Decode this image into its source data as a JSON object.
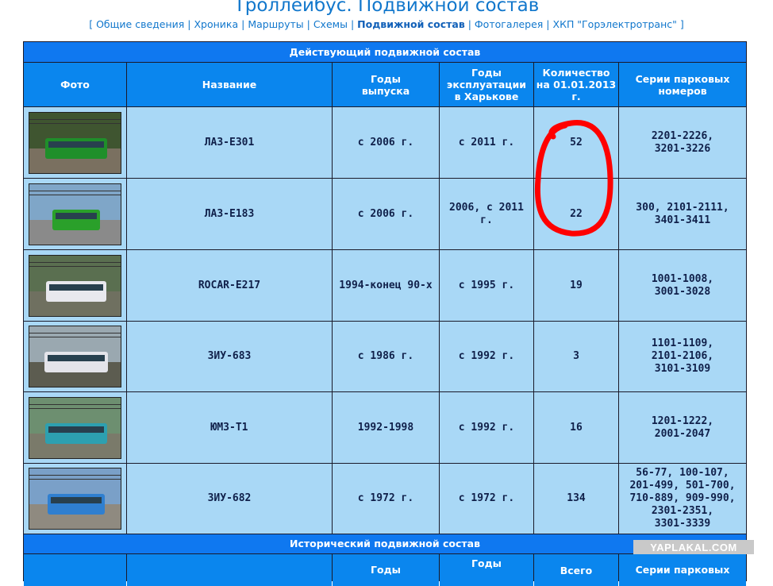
{
  "page": {
    "title": "Троллейбус. Подвижной состав"
  },
  "nav": {
    "open": "[",
    "close": "]",
    "sep": "|",
    "items": [
      {
        "label": "Общие сведения",
        "current": false
      },
      {
        "label": "Хроника",
        "current": false
      },
      {
        "label": "Маршруты",
        "current": false
      },
      {
        "label": "Схемы",
        "current": false
      },
      {
        "label": "Подвижной состав",
        "current": true
      },
      {
        "label": "Фотогалерея",
        "current": false
      },
      {
        "label": "ХКП \"Горэлектротранс\"",
        "current": false
      }
    ]
  },
  "active": {
    "band": "Действующий подвижной состав",
    "headers": {
      "photo": "Фото",
      "name": "Название",
      "years": "Годы выпуска",
      "exploit": "Годы эксплуатации в Харькове",
      "count": "Количество на 01.01.2013 г.",
      "series": "Серии парковых номеров"
    },
    "rows": [
      {
        "name": "ЛАЗ-Е301",
        "years": "с 2006 г.",
        "exploit": "с 2011 г.",
        "count": "52",
        "series": [
          "2201-2226,",
          "3201-3226"
        ]
      },
      {
        "name": "ЛАЗ-Е183",
        "years": "с 2006 г.",
        "exploit": "2006, с 2011 г.",
        "count": "22",
        "series": [
          "300, 2101-2111,",
          "3401-3411"
        ]
      },
      {
        "name": "ROCAR-E217",
        "years": "1994-конец 90-х",
        "exploit": "с 1995 г.",
        "count": "19",
        "series": [
          "1001-1008,",
          "3001-3028"
        ]
      },
      {
        "name": "ЗИУ-683",
        "years": "с 1986 г.",
        "exploit": "с 1992 г.",
        "count": "3",
        "series": [
          "1101-1109,",
          "2101-2106,",
          "3101-3109"
        ]
      },
      {
        "name": "ЮМЗ-Т1",
        "years": "1992-1998",
        "exploit": "с 1992 г.",
        "count": "16",
        "series": [
          "1201-1222,",
          "2001-2047"
        ]
      },
      {
        "name": "ЗИУ-682",
        "years": "с 1972 г.",
        "exploit": "с 1972 г.",
        "count": "134",
        "series": [
          "56-77, 100-107,",
          "201-499, 501-700,",
          "710-889, 909-990,",
          "2301-2351,",
          "3301-3339"
        ]
      }
    ]
  },
  "historic": {
    "band": "Исторический подвижной состав",
    "headers": {
      "years": "Годы",
      "exploit": "Годы",
      "total": "Всего",
      "series": "Серии парковых"
    }
  },
  "watermark": "YAPLAKAL.COM",
  "colors": {
    "accent": "#0a86ee",
    "band": "#0f78f0",
    "row": "#a9d8f6",
    "link": "#1177cc",
    "mark": "#ff0000"
  }
}
